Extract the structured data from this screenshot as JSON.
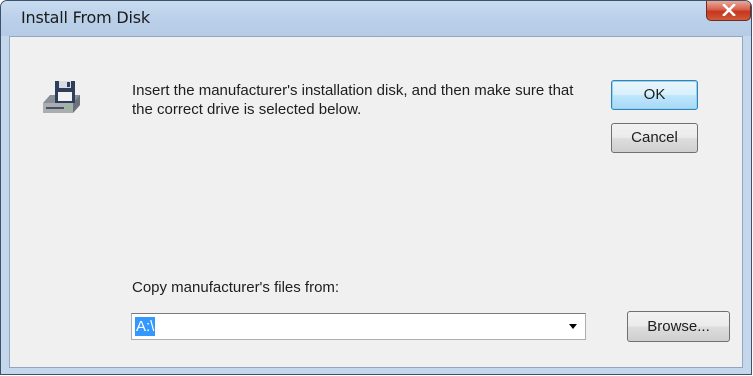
{
  "window": {
    "title": "Install From Disk"
  },
  "dialog": {
    "instruction": "Insert the manufacturer's installation disk, and then make sure that the correct drive is selected below.",
    "ok_label": "OK",
    "cancel_label": "Cancel",
    "copy_label": "Copy manufacturer's files from:",
    "path_value": "A:\\",
    "browse_label": "Browse..."
  },
  "icons": {
    "close": "close-icon",
    "disk": "floppy-disk-drive-icon",
    "dropdown": "chevron-down-icon"
  },
  "colors": {
    "close_button": "#c4351f",
    "selection": "#3399ff",
    "default_button_border": "#3c7fb1"
  }
}
